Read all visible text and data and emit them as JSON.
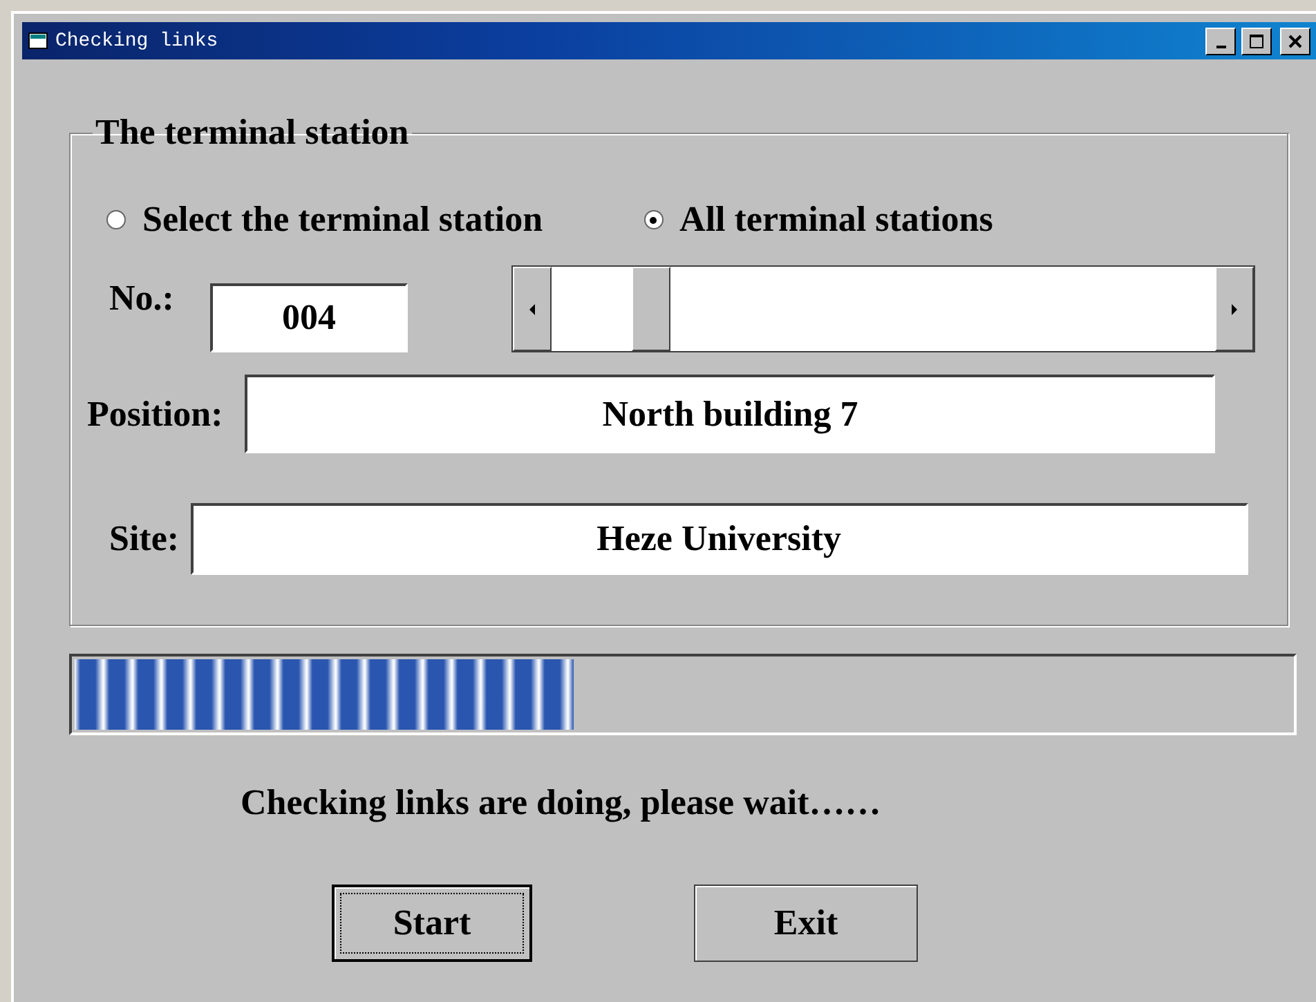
{
  "window": {
    "title": "Checking links"
  },
  "group": {
    "title": "The terminal station",
    "radios": [
      {
        "label": "Select the terminal station",
        "selected": false
      },
      {
        "label": "All terminal stations",
        "selected": true
      }
    ],
    "number": {
      "label": "No.:",
      "value": "004"
    },
    "position": {
      "label": "Position:",
      "value": "North building 7"
    },
    "site": {
      "label": "Site:",
      "value": "Heze University"
    }
  },
  "progress": {
    "level": 0.41
  },
  "status": "Checking links are doing, please wait……",
  "buttons": [
    {
      "label": "Start",
      "focused": true
    },
    {
      "label": "Exit",
      "focused": false
    }
  ]
}
